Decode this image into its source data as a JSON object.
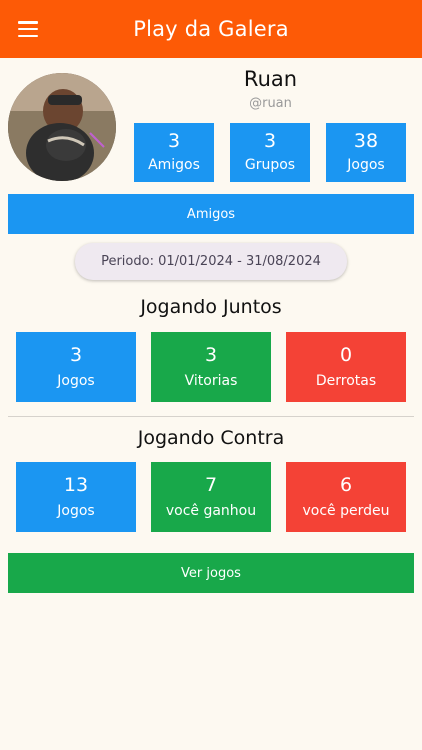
{
  "appbar": {
    "title": "Play da Galera",
    "menu_icon": "menu-icon"
  },
  "profile": {
    "name": "Ruan",
    "handle": "@ruan",
    "stats": [
      {
        "value": "3",
        "label": "Amigos"
      },
      {
        "value": "3",
        "label": "Grupos"
      },
      {
        "value": "38",
        "label": "Jogos"
      }
    ]
  },
  "buttons": {
    "friends": "Amigos",
    "games": "Ver jogos"
  },
  "period": "Periodo: 01/01/2024 - 31/08/2024",
  "together": {
    "title": "Jogando Juntos",
    "cards": [
      {
        "value": "3",
        "label": "Jogos"
      },
      {
        "value": "3",
        "label": "Vitorias"
      },
      {
        "value": "0",
        "label": "Derrotas"
      }
    ]
  },
  "against": {
    "title": "Jogando Contra",
    "cards": [
      {
        "value": "13",
        "label": "Jogos"
      },
      {
        "value": "7",
        "label": "você ganhou"
      },
      {
        "value": "6",
        "label": "você perdeu"
      }
    ]
  },
  "colors": {
    "appbar": "#fd5a06",
    "blue": "#1b96f2",
    "green": "#18a84a",
    "red": "#f44236",
    "background": "#fdf9f1"
  }
}
